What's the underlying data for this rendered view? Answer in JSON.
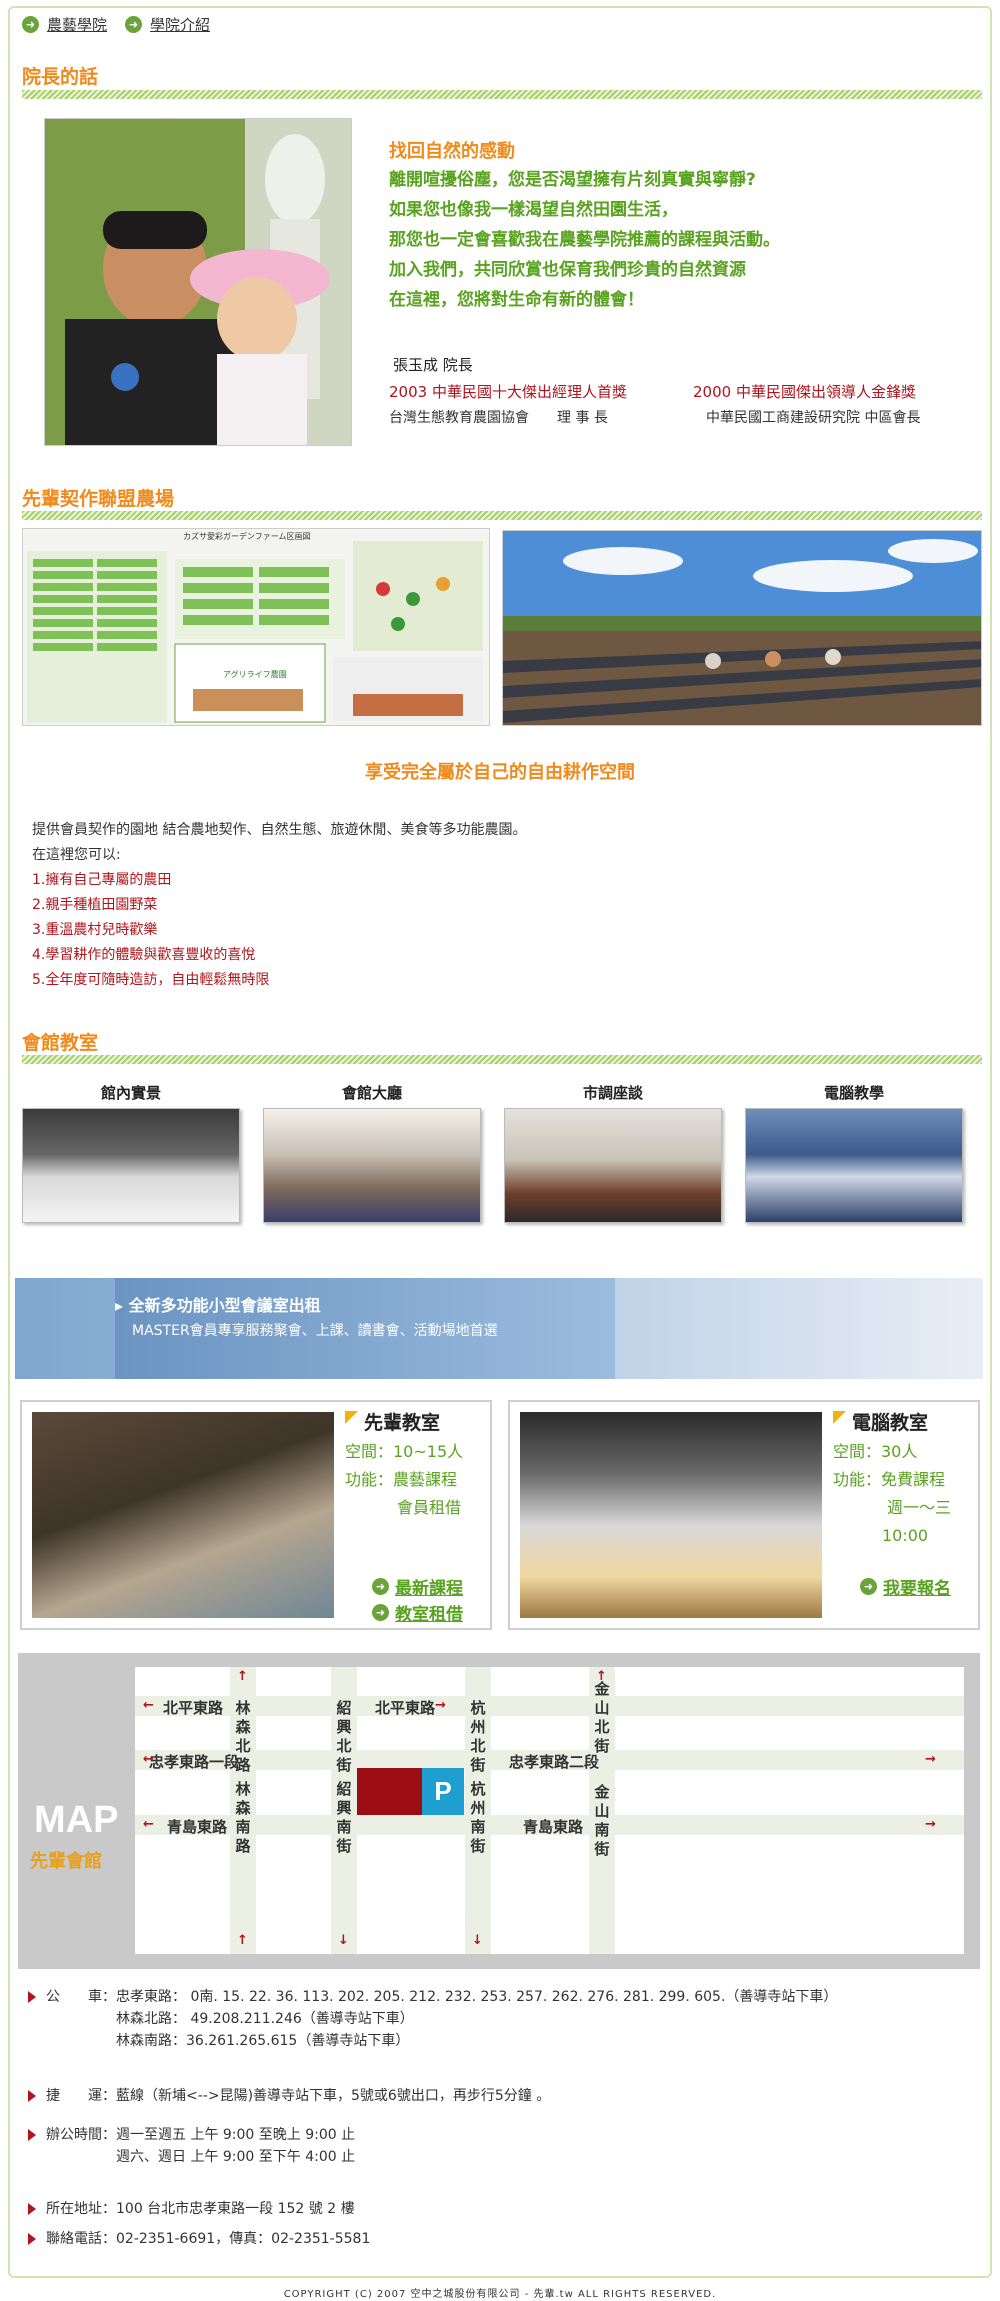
{
  "breadcrumb": {
    "item1": "農藝學院",
    "item2": "學院介紹"
  },
  "principal": {
    "section_title": "院長的話",
    "heading": "找回自然的感動",
    "lines": [
      "離開喧擾俗塵，您是否渴望擁有片刻真實與寧靜?",
      "如果您也像我一樣渴望自然田園生活，",
      "那您也一定會喜歡我在農藝學院推薦的課程與活動。",
      "加入我們，共同欣賞也保育我們珍貴的自然資源",
      "在這裡，您將對生命有新的體會！"
    ],
    "name": "張玉成 院長",
    "award1": "2003 中華民國十大傑出經理人首獎",
    "award2": "2000 中華民國傑出領導人金鋒獎",
    "org1": "台灣生態教育農園協會　　理 事 長",
    "org2": "中華民國工商建設研究院 中區會長"
  },
  "farm": {
    "section_title": "先輩契作聯盟農場",
    "plan_title": "カズサ愛彩ガーデンファーム区画図",
    "plan_logo": "アグリライフ農園",
    "tagline": "享受完全屬於自己的自由耕作空間",
    "intro1": "提供會員契作的園地 結合農地契作、自然生態、旅遊休閒、美食等多功能農園。",
    "intro2": "在這裡您可以:",
    "points": [
      "1.擁有自己專屬的農田",
      "2.親手種植田園野菜",
      "3.重溫農村兒時歡樂",
      "4.學習耕作的體驗與歡喜豐收的喜悅",
      "5.全年度可隨時造訪，自由輕鬆無時限"
    ]
  },
  "hall": {
    "section_title": "會館教室",
    "thumbs": [
      "館內實景",
      "會館大廳",
      "市調座談",
      "電腦教學"
    ],
    "banner_title": "全新多功能小型會議室出租",
    "banner_sub": "MASTER會員專享服務聚會、上課、讀書會、活動場地首選"
  },
  "classroom1": {
    "title": "先輩教室",
    "space": "空間：10~15人",
    "func1": "功能：農藝課程",
    "func2": "會員租借",
    "link1": "最新課程",
    "link2": "教室租借"
  },
  "classroom2": {
    "title": "電腦教室",
    "space": "空間：30人",
    "func1": "功能：免費課程",
    "func2": "週一～三",
    "func3": "10:00",
    "link1": "我要報名"
  },
  "map": {
    "label": "MAP",
    "sublabel": "先輩會館",
    "roads": {
      "beiping1": "北平東路",
      "beiping2": "北平東路",
      "zhongxiao1": "忠孝東路一段",
      "zhongxiao2": "忠孝東路二段",
      "qingdao1": "青島東路",
      "qingdao2": "青島東路",
      "linsen_n": "林森北路",
      "linsen_s": "林森南路",
      "shaoxing_n": "紹興北街",
      "shaoxing_s": "紹興南街",
      "hangzhou_n": "杭州北街",
      "hangzhou_s": "杭州南街",
      "jinshan_n": "金山北街",
      "jinshan_s": "金山南街"
    },
    "parking": "P"
  },
  "info": {
    "bus_label": "公　　車：",
    "bus1": "忠孝東路：  0南. 15. 22. 36. 113. 202. 205. 212. 232. 253. 257. 262. 276. 281. 299. 605.（善導寺站下車）",
    "bus2": "林森北路：  49.208.211.246（善導寺站下車）",
    "bus3": "林森南路：36.261.265.615（善導寺站下車）",
    "mrt_label": "捷　　運：",
    "mrt": "藍線（新埔<-->昆陽)善導寺站下車，5號或6號出口，再步行5分鐘 。",
    "hours_label": "辦公時間：",
    "hours1": "週一至週五  上午 9:00  至晚上 9:00  止",
    "hours2": "週六、週日  上午 9:00  至下午 4:00  止",
    "addr_label": "所在地址：",
    "addr": "100 台北市忠孝東路一段 152 號 2 樓",
    "tel_label": "聯絡電話：",
    "tel": "02-2351-6691，傳真：02-2351-5581"
  },
  "footer": "COPYRIGHT (C) 2007 空中之城股份有限公司 - 先輩.tw ALL RIGHTS RESERVED.",
  "colors": {
    "green": "#5aa321",
    "orange": "#f08a1c",
    "red": "#b0141c",
    "map_block": "#9b0d12",
    "parking": "#1f9fd0"
  }
}
